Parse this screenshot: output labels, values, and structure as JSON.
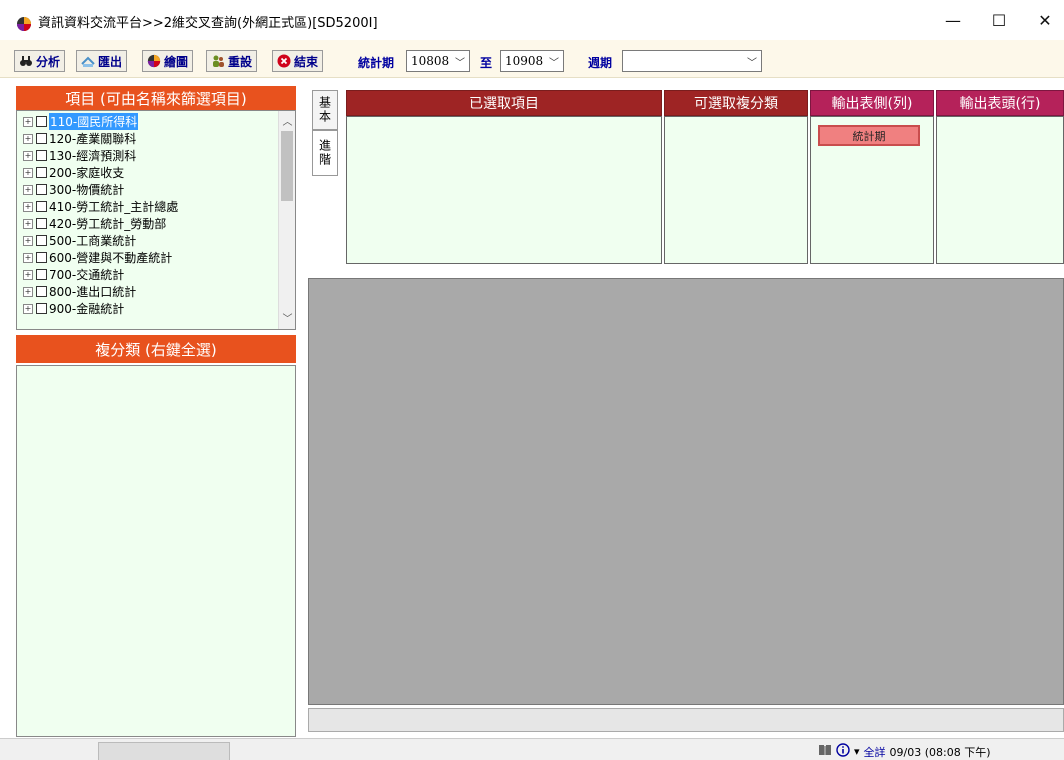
{
  "window": {
    "title": "資訊資料交流平台>>2維交叉查詢(外網正式區)[SD5200I]",
    "min_symbol": "—",
    "max_symbol": "☐",
    "close_symbol": "✕"
  },
  "toolbar": {
    "analyze_label": "分析",
    "export_label": "匯出",
    "draw_label": "繪圖",
    "reset_label": "重設",
    "exit_label": "結束",
    "period_label": "統計期",
    "period_from": "10808",
    "to_label": "至",
    "period_to": "10908",
    "cycle_label": "週期",
    "cycle_value": ""
  },
  "left": {
    "items_header": "項目 (可由名稱來篩選項目)",
    "tree": [
      {
        "label": "110-國民所得科",
        "selected": true
      },
      {
        "label": "120-產業關聯科",
        "selected": false
      },
      {
        "label": "130-經濟預測科",
        "selected": false
      },
      {
        "label": "200-家庭收支",
        "selected": false
      },
      {
        "label": "300-物價統計",
        "selected": false
      },
      {
        "label": "410-勞工統計_主計總處",
        "selected": false
      },
      {
        "label": "420-勞工統計_勞動部",
        "selected": false
      },
      {
        "label": "500-工商業統計",
        "selected": false
      },
      {
        "label": "600-營建與不動產統計",
        "selected": false
      },
      {
        "label": "700-交通統計",
        "selected": false
      },
      {
        "label": "800-進出口統計",
        "selected": false
      },
      {
        "label": "900-金融統計",
        "selected": false
      }
    ],
    "multi_header": "複分類 (右鍵全選)"
  },
  "tabs": {
    "basic": "基本",
    "advanced": "進階"
  },
  "columns": {
    "selected_items": "已選取項目",
    "available_classes": "可選取複分類",
    "output_row": "輸出表側(列)",
    "output_col": "輸出表頭(行)",
    "chip": "統計期"
  },
  "colors": {
    "dark_red": "#9e2424",
    "orange": "#e8521e",
    "magenta": "#b5225a",
    "pale_green": "#f0fff0"
  },
  "status": {
    "mode": "全詳",
    "datetime": "09/03 (08:08 下午)"
  }
}
